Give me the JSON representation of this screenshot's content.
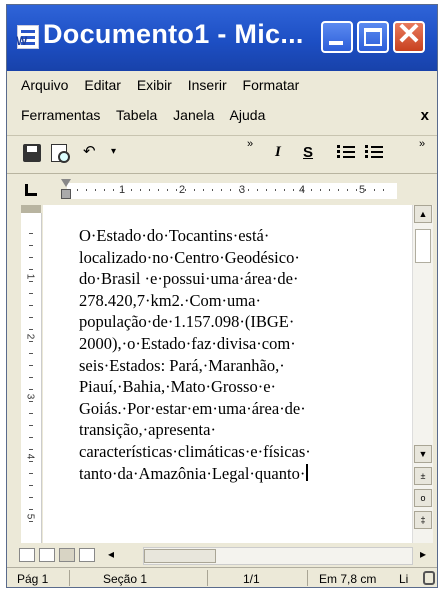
{
  "window": {
    "title": "Documento1 - Mic...",
    "min_glyph": "_",
    "max_glyph": "□",
    "close_glyph": "✕"
  },
  "menu": {
    "row1": [
      "Arquivo",
      "Editar",
      "Exibir",
      "Inserir",
      "Formatar"
    ],
    "row2": [
      "Ferramentas",
      "Tabela",
      "Janela",
      "Ajuda"
    ],
    "doc_close": "x"
  },
  "toolbar": {
    "undo_symbol": "↶",
    "dropdown_arrow": "▾",
    "chevron": "»",
    "italic": "I",
    "underline": "S"
  },
  "ruler": {
    "ticks": [
      "1",
      "2",
      "3",
      "4",
      "5"
    ]
  },
  "vruler": {
    "ticks": [
      "1",
      "2",
      "3",
      "4",
      "5"
    ]
  },
  "document": {
    "lines": [
      "O·Estado·do·Tocantins·está·",
      "localizado·no·Centro·Geodésico·",
      "do·Brasil ·e·possui·uma·área·de·",
      "278.420,7·km2.·Com·uma·",
      "população·de·1.157.098·(IBGE·",
      "2000),·o·Estado·faz·divisa·com·",
      "seis·Estados: Pará,·Maranhão,·",
      "Piauí,·Bahia,·Mato·Grosso·e·",
      "Goiás.·Por·estar·em·uma·área·de·",
      "transição,·apresenta·",
      "características·climáticas·e·físicas·",
      "tanto·da·Amazônia·Legal·quanto·"
    ]
  },
  "scrollbar": {
    "up": "▲",
    "down": "▼",
    "prev_page": "±",
    "browse_object": "o",
    "next_page": "‡"
  },
  "viewbar": {
    "scroll_left": "◂",
    "scroll_right": "▸"
  },
  "status": {
    "page": "Pág 1",
    "section": "Seção 1",
    "page_count": "1/1",
    "position": "Em 7,8 cm",
    "line": "Li"
  }
}
